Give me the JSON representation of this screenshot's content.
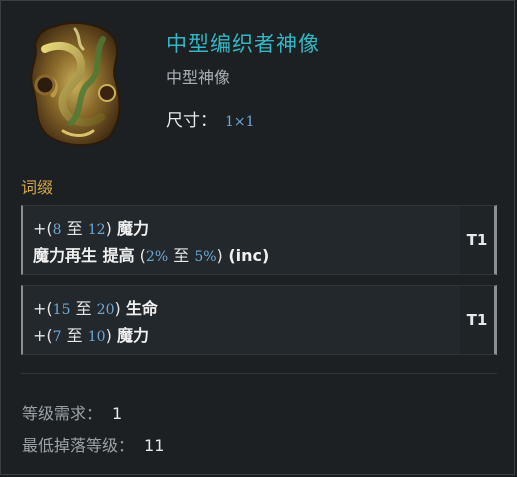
{
  "item": {
    "name": "中型编织者神像",
    "type": "中型神像",
    "size_label": "尺寸：",
    "size_value": "1×1",
    "icon": "idol-icon",
    "colors": {
      "title": "#35b6c4",
      "section": "#d3a64a",
      "number": "#6da8d4"
    }
  },
  "affixes_title": "词缀",
  "affixes": [
    {
      "tier": "T1",
      "lines": [
        {
          "prefix": "+(",
          "min": "8",
          "sep": " 至 ",
          "max": "12",
          "close": ")",
          "stat": "魔力",
          "suffix": ""
        },
        {
          "prefix": "",
          "lead_stat": "魔力再生 提高",
          "open": " (",
          "min": "2%",
          "sep": " 至 ",
          "max": "5%",
          "close": ")",
          "suffix": " (inc)"
        }
      ]
    },
    {
      "tier": "T1",
      "lines": [
        {
          "prefix": "+(",
          "min": "15",
          "sep": " 至 ",
          "max": "20",
          "close": ")",
          "stat": "生命",
          "suffix": ""
        },
        {
          "prefix": "+(",
          "min": "7",
          "sep": " 至 ",
          "max": "10",
          "close": ")",
          "stat": "魔力",
          "suffix": ""
        }
      ]
    }
  ],
  "requirements": [
    {
      "label": "等级需求：",
      "value": "1"
    },
    {
      "label": "最低掉落等级：",
      "value": "11"
    }
  ]
}
